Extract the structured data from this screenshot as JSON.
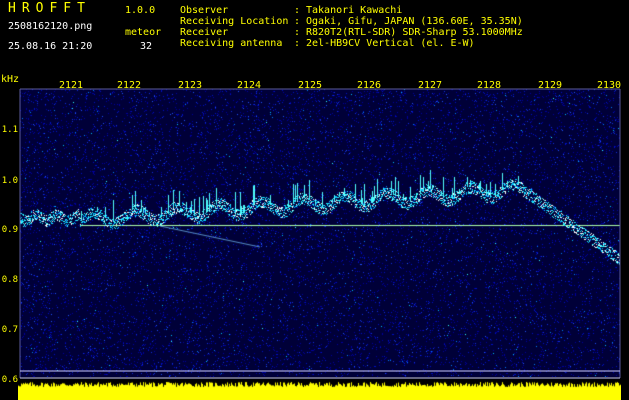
{
  "header": {
    "app_title": "HROFFT",
    "app_version": "1.0.0",
    "file_name": "2508162120.png",
    "meteor_label": "meteor",
    "timestamp": "25.08.16 21:20",
    "meteor_count": "32"
  },
  "info": [
    {
      "key": "Observer",
      "sep": ":",
      "value": "Takanori Kawachi"
    },
    {
      "key": "Receiving Location",
      "sep": ":",
      "value": "Ogaki, Gifu, JAPAN (136.60E, 35.35N)"
    },
    {
      "key": "Receiver",
      "sep": ":",
      "value": "R820T2(RTL-SDR) SDR-Sharp 53.1000MHz"
    },
    {
      "key": "Receiving antenna",
      "sep": ":",
      "value": "2el-HB9CV Vertical (el. E-W)"
    }
  ],
  "axes": {
    "y_unit": "kHz",
    "y_ticks": [
      "1.1",
      "1.0",
      "0.9",
      "0.8",
      "0.7",
      "0.6"
    ],
    "x_ticks": [
      "2121",
      "2122",
      "2123",
      "2124",
      "2125",
      "2126",
      "2127",
      "2128",
      "2129",
      "2130"
    ]
  },
  "colors": {
    "text": "#ffff00",
    "background": "#000000",
    "noise_floor": "#000038",
    "signal": "#00ffff",
    "carrier": "#aaffaa",
    "strip": "#ffff00"
  }
}
